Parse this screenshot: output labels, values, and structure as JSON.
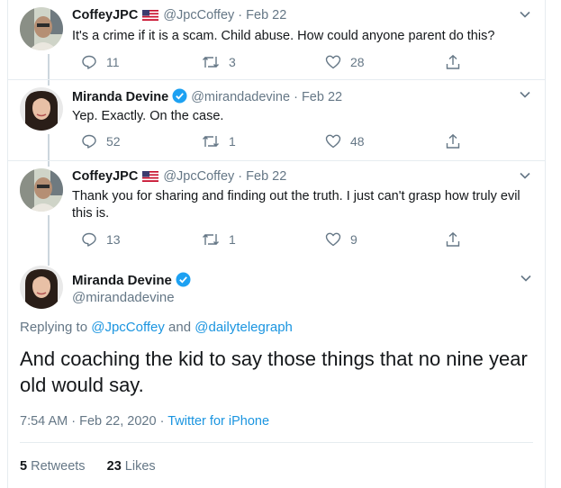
{
  "replies": [
    {
      "name": "CoffeyJPC",
      "handle": "@JpcCoffey",
      "date": "Feb 22",
      "text": "It's a crime if it is a scam. Child abuse. How could anyone parent do this?",
      "reply_count": "11",
      "retweet_count": "3",
      "like_count": "28"
    },
    {
      "name": "Miranda Devine",
      "handle": "@mirandadevine",
      "date": "Feb 22",
      "text": "Yep. Exactly. On the case.",
      "reply_count": "52",
      "retweet_count": "1",
      "like_count": "48"
    },
    {
      "name": "CoffeyJPC",
      "handle": "@JpcCoffey",
      "date": "Feb 22",
      "text": "Thank you for sharing and finding out the truth. I just can't grasp how truly evil this is.",
      "reply_count": "13",
      "retweet_count": "1",
      "like_count": "9"
    }
  ],
  "main": {
    "name": "Miranda Devine",
    "handle": "@mirandadevine",
    "replying_prefix": "Replying to",
    "replying_user1": "@JpcCoffey",
    "replying_and": "and",
    "replying_user2": "@dailytelegraph",
    "text": "And coaching the kid to say those things that no nine year old would say.",
    "timestamp": "7:54 AM · Feb 22, 2020 ·",
    "source": "Twitter for iPhone",
    "retweets_count": "5",
    "retweets_label": "Retweets",
    "likes_count": "23",
    "likes_label": "Likes"
  },
  "colors": {
    "link": "#1b95e0",
    "secondary": "#657786",
    "verified": "#1da1f2"
  }
}
